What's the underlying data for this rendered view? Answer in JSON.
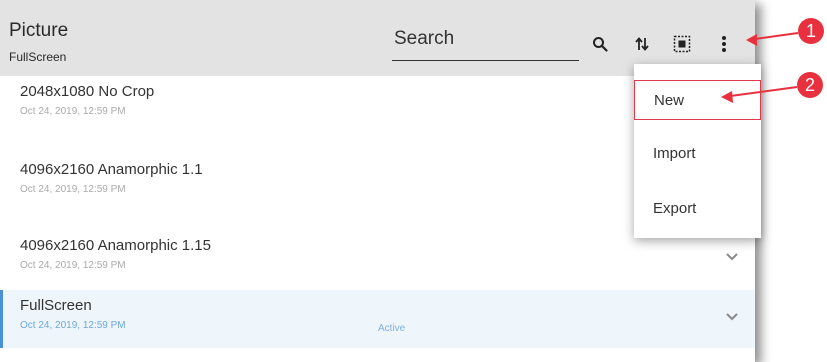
{
  "header": {
    "title": "Picture",
    "subtitle": "FullScreen",
    "search_placeholder": "Search",
    "icons": [
      "search-icon",
      "sort-icon",
      "select-all-icon",
      "more-vert-icon"
    ]
  },
  "rows": [
    {
      "name": "2048x1080 No Crop",
      "date": "Oct 24, 2019, 12:59 PM"
    },
    {
      "name": "4096x2160 Anamorphic 1.1",
      "date": "Oct 24, 2019, 12:59 PM"
    },
    {
      "name": "4096x2160 Anamorphic 1.15",
      "date": "Oct 24, 2019, 12:59 PM"
    },
    {
      "name": "FullScreen",
      "date": "Oct 24, 2019, 12:59 PM",
      "extra": "Active"
    }
  ],
  "menu": {
    "items": [
      "New",
      "Import",
      "Export"
    ]
  },
  "callouts": [
    "1",
    "2"
  ],
  "colors": {
    "header_bg": "#e3e3e3",
    "accent": "#4a90d9",
    "callout": "#e8303e"
  }
}
